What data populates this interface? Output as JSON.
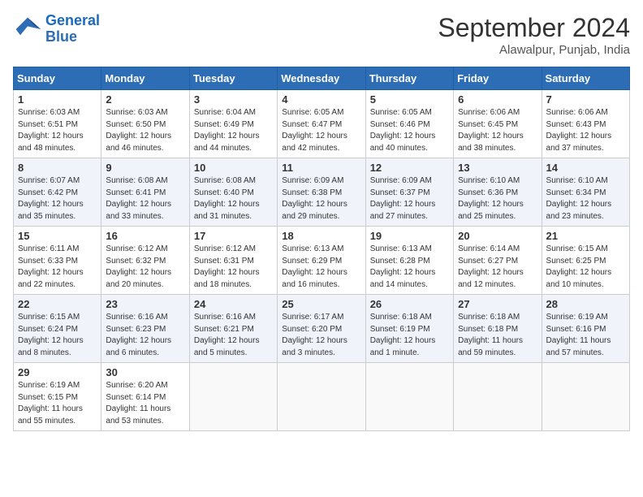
{
  "header": {
    "logo_line1": "General",
    "logo_line2": "Blue",
    "month": "September 2024",
    "location": "Alawalpur, Punjab, India"
  },
  "days_of_week": [
    "Sunday",
    "Monday",
    "Tuesday",
    "Wednesday",
    "Thursday",
    "Friday",
    "Saturday"
  ],
  "weeks": [
    [
      {
        "day": "1",
        "info": "Sunrise: 6:03 AM\nSunset: 6:51 PM\nDaylight: 12 hours\nand 48 minutes."
      },
      {
        "day": "2",
        "info": "Sunrise: 6:03 AM\nSunset: 6:50 PM\nDaylight: 12 hours\nand 46 minutes."
      },
      {
        "day": "3",
        "info": "Sunrise: 6:04 AM\nSunset: 6:49 PM\nDaylight: 12 hours\nand 44 minutes."
      },
      {
        "day": "4",
        "info": "Sunrise: 6:05 AM\nSunset: 6:47 PM\nDaylight: 12 hours\nand 42 minutes."
      },
      {
        "day": "5",
        "info": "Sunrise: 6:05 AM\nSunset: 6:46 PM\nDaylight: 12 hours\nand 40 minutes."
      },
      {
        "day": "6",
        "info": "Sunrise: 6:06 AM\nSunset: 6:45 PM\nDaylight: 12 hours\nand 38 minutes."
      },
      {
        "day": "7",
        "info": "Sunrise: 6:06 AM\nSunset: 6:43 PM\nDaylight: 12 hours\nand 37 minutes."
      }
    ],
    [
      {
        "day": "8",
        "info": "Sunrise: 6:07 AM\nSunset: 6:42 PM\nDaylight: 12 hours\nand 35 minutes."
      },
      {
        "day": "9",
        "info": "Sunrise: 6:08 AM\nSunset: 6:41 PM\nDaylight: 12 hours\nand 33 minutes."
      },
      {
        "day": "10",
        "info": "Sunrise: 6:08 AM\nSunset: 6:40 PM\nDaylight: 12 hours\nand 31 minutes."
      },
      {
        "day": "11",
        "info": "Sunrise: 6:09 AM\nSunset: 6:38 PM\nDaylight: 12 hours\nand 29 minutes."
      },
      {
        "day": "12",
        "info": "Sunrise: 6:09 AM\nSunset: 6:37 PM\nDaylight: 12 hours\nand 27 minutes."
      },
      {
        "day": "13",
        "info": "Sunrise: 6:10 AM\nSunset: 6:36 PM\nDaylight: 12 hours\nand 25 minutes."
      },
      {
        "day": "14",
        "info": "Sunrise: 6:10 AM\nSunset: 6:34 PM\nDaylight: 12 hours\nand 23 minutes."
      }
    ],
    [
      {
        "day": "15",
        "info": "Sunrise: 6:11 AM\nSunset: 6:33 PM\nDaylight: 12 hours\nand 22 minutes."
      },
      {
        "day": "16",
        "info": "Sunrise: 6:12 AM\nSunset: 6:32 PM\nDaylight: 12 hours\nand 20 minutes."
      },
      {
        "day": "17",
        "info": "Sunrise: 6:12 AM\nSunset: 6:31 PM\nDaylight: 12 hours\nand 18 minutes."
      },
      {
        "day": "18",
        "info": "Sunrise: 6:13 AM\nSunset: 6:29 PM\nDaylight: 12 hours\nand 16 minutes."
      },
      {
        "day": "19",
        "info": "Sunrise: 6:13 AM\nSunset: 6:28 PM\nDaylight: 12 hours\nand 14 minutes."
      },
      {
        "day": "20",
        "info": "Sunrise: 6:14 AM\nSunset: 6:27 PM\nDaylight: 12 hours\nand 12 minutes."
      },
      {
        "day": "21",
        "info": "Sunrise: 6:15 AM\nSunset: 6:25 PM\nDaylight: 12 hours\nand 10 minutes."
      }
    ],
    [
      {
        "day": "22",
        "info": "Sunrise: 6:15 AM\nSunset: 6:24 PM\nDaylight: 12 hours\nand 8 minutes."
      },
      {
        "day": "23",
        "info": "Sunrise: 6:16 AM\nSunset: 6:23 PM\nDaylight: 12 hours\nand 6 minutes."
      },
      {
        "day": "24",
        "info": "Sunrise: 6:16 AM\nSunset: 6:21 PM\nDaylight: 12 hours\nand 5 minutes."
      },
      {
        "day": "25",
        "info": "Sunrise: 6:17 AM\nSunset: 6:20 PM\nDaylight: 12 hours\nand 3 minutes."
      },
      {
        "day": "26",
        "info": "Sunrise: 6:18 AM\nSunset: 6:19 PM\nDaylight: 12 hours\nand 1 minute."
      },
      {
        "day": "27",
        "info": "Sunrise: 6:18 AM\nSunset: 6:18 PM\nDaylight: 11 hours\nand 59 minutes."
      },
      {
        "day": "28",
        "info": "Sunrise: 6:19 AM\nSunset: 6:16 PM\nDaylight: 11 hours\nand 57 minutes."
      }
    ],
    [
      {
        "day": "29",
        "info": "Sunrise: 6:19 AM\nSunset: 6:15 PM\nDaylight: 11 hours\nand 55 minutes."
      },
      {
        "day": "30",
        "info": "Sunrise: 6:20 AM\nSunset: 6:14 PM\nDaylight: 11 hours\nand 53 minutes."
      },
      null,
      null,
      null,
      null,
      null
    ]
  ]
}
